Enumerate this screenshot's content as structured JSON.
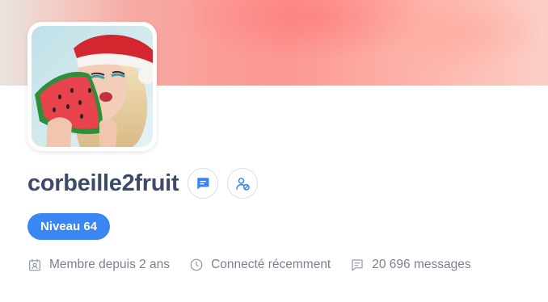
{
  "profile": {
    "username": "corbeille2fruit",
    "level_label": "Niveau 64",
    "avatar_alt": "avatar",
    "actions": {
      "message_icon": "chat-bubble-icon",
      "block_icon": "user-block-icon"
    },
    "stats": {
      "member_since": "Membre depuis 2 ans",
      "last_seen": "Connecté récemment",
      "messages": "20 696 messages"
    }
  },
  "colors": {
    "accent": "#3a86f3",
    "username": "#3c4a6b",
    "muted_text": "#7a8190",
    "icon_muted": "#9aa1ad"
  }
}
